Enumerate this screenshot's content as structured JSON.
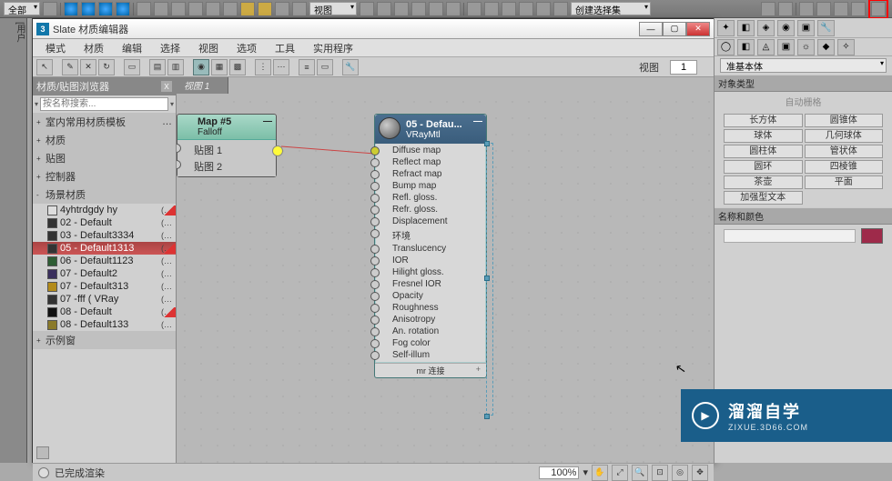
{
  "main_toolbar": {
    "scope": "全部",
    "view_label": "视图",
    "create_sel_label": "创建选择集"
  },
  "left_strip": {
    "label": "[用户"
  },
  "window": {
    "icon_text": "3",
    "title": "Slate 材质编辑器",
    "menus": [
      "模式",
      "材质",
      "编辑",
      "选择",
      "视图",
      "选项",
      "工具",
      "实用程序"
    ],
    "view_label": "视图",
    "view_number": "1",
    "tab": "视图 1"
  },
  "browser": {
    "title": "材质/贴图浏览器",
    "search_placeholder": "按名称搜索...",
    "sections": [
      {
        "label": "室内常用材质模板",
        "expanded": false,
        "dots": true
      },
      {
        "label": "材质",
        "expanded": false
      },
      {
        "label": "贴图",
        "expanded": false
      },
      {
        "label": "控制器",
        "expanded": false
      },
      {
        "label": "场景材质",
        "expanded": true,
        "items": [
          {
            "swatch": "#dddddd",
            "label": "4yhtrdgdy hy",
            "dots": true,
            "flag": true
          },
          {
            "swatch": "#333333",
            "label": "02 - Default",
            "dots": true
          },
          {
            "swatch": "#333333",
            "label": "03 - Default3334",
            "dots": true
          },
          {
            "swatch": "#333333",
            "label": "05 - Default1313",
            "dots": true,
            "selected": true,
            "flag": true
          },
          {
            "swatch": "#2e5d34",
            "label": "06 - Default1123",
            "dots": true
          },
          {
            "swatch": "#3a2f5d",
            "label": "07 - Default2",
            "dots": true
          },
          {
            "swatch": "#b38b1a",
            "label": "07 - Default313",
            "dots": true
          },
          {
            "swatch": "#333333",
            "label": "07 -fff  ( VRay",
            "dots": true
          },
          {
            "swatch": "#111111",
            "label": "08 - Default",
            "dots": true,
            "flag": true
          },
          {
            "swatch": "#8a7a2a",
            "label": "08 - Default133",
            "dots": true
          }
        ]
      },
      {
        "label": "示例窗",
        "expanded": false
      }
    ]
  },
  "node_a": {
    "title": "Map #5",
    "sub": "Falloff",
    "rows": [
      "贴图 1",
      "贴图 2"
    ]
  },
  "node_b": {
    "title": "05 - Defau...",
    "sub": "VRayMtl",
    "rows": [
      "Diffuse map",
      "Reflect map",
      "Refract map",
      "Bump map",
      "Refl. gloss.",
      "Refr. gloss.",
      "Displacement",
      "环境",
      "Translucency",
      "IOR",
      "Hilight gloss.",
      "Fresnel IOR",
      "Opacity",
      "Roughness",
      "Anisotropy",
      "An. rotation",
      "Fog color",
      "Self-illum"
    ],
    "footer": "mr 连接"
  },
  "status": {
    "text": "已完成渲染",
    "zoom": "100%"
  },
  "right_panel": {
    "primitive_label": "准基本体",
    "obj_type_label": "对象类型",
    "auto_grid": "自动栅格",
    "primitives": [
      "长方体",
      "圆锥体",
      "球体",
      "几何球体",
      "圆柱体",
      "管状体",
      "圆环",
      "四棱锥",
      "茶壶",
      "平面",
      "加强型文本",
      ""
    ],
    "name_color_label": "名称和颜色",
    "swatch": "#9e2a4a"
  },
  "watermark": {
    "cn": "溜溜自学",
    "en": "ZIXUE.3D66.COM"
  }
}
